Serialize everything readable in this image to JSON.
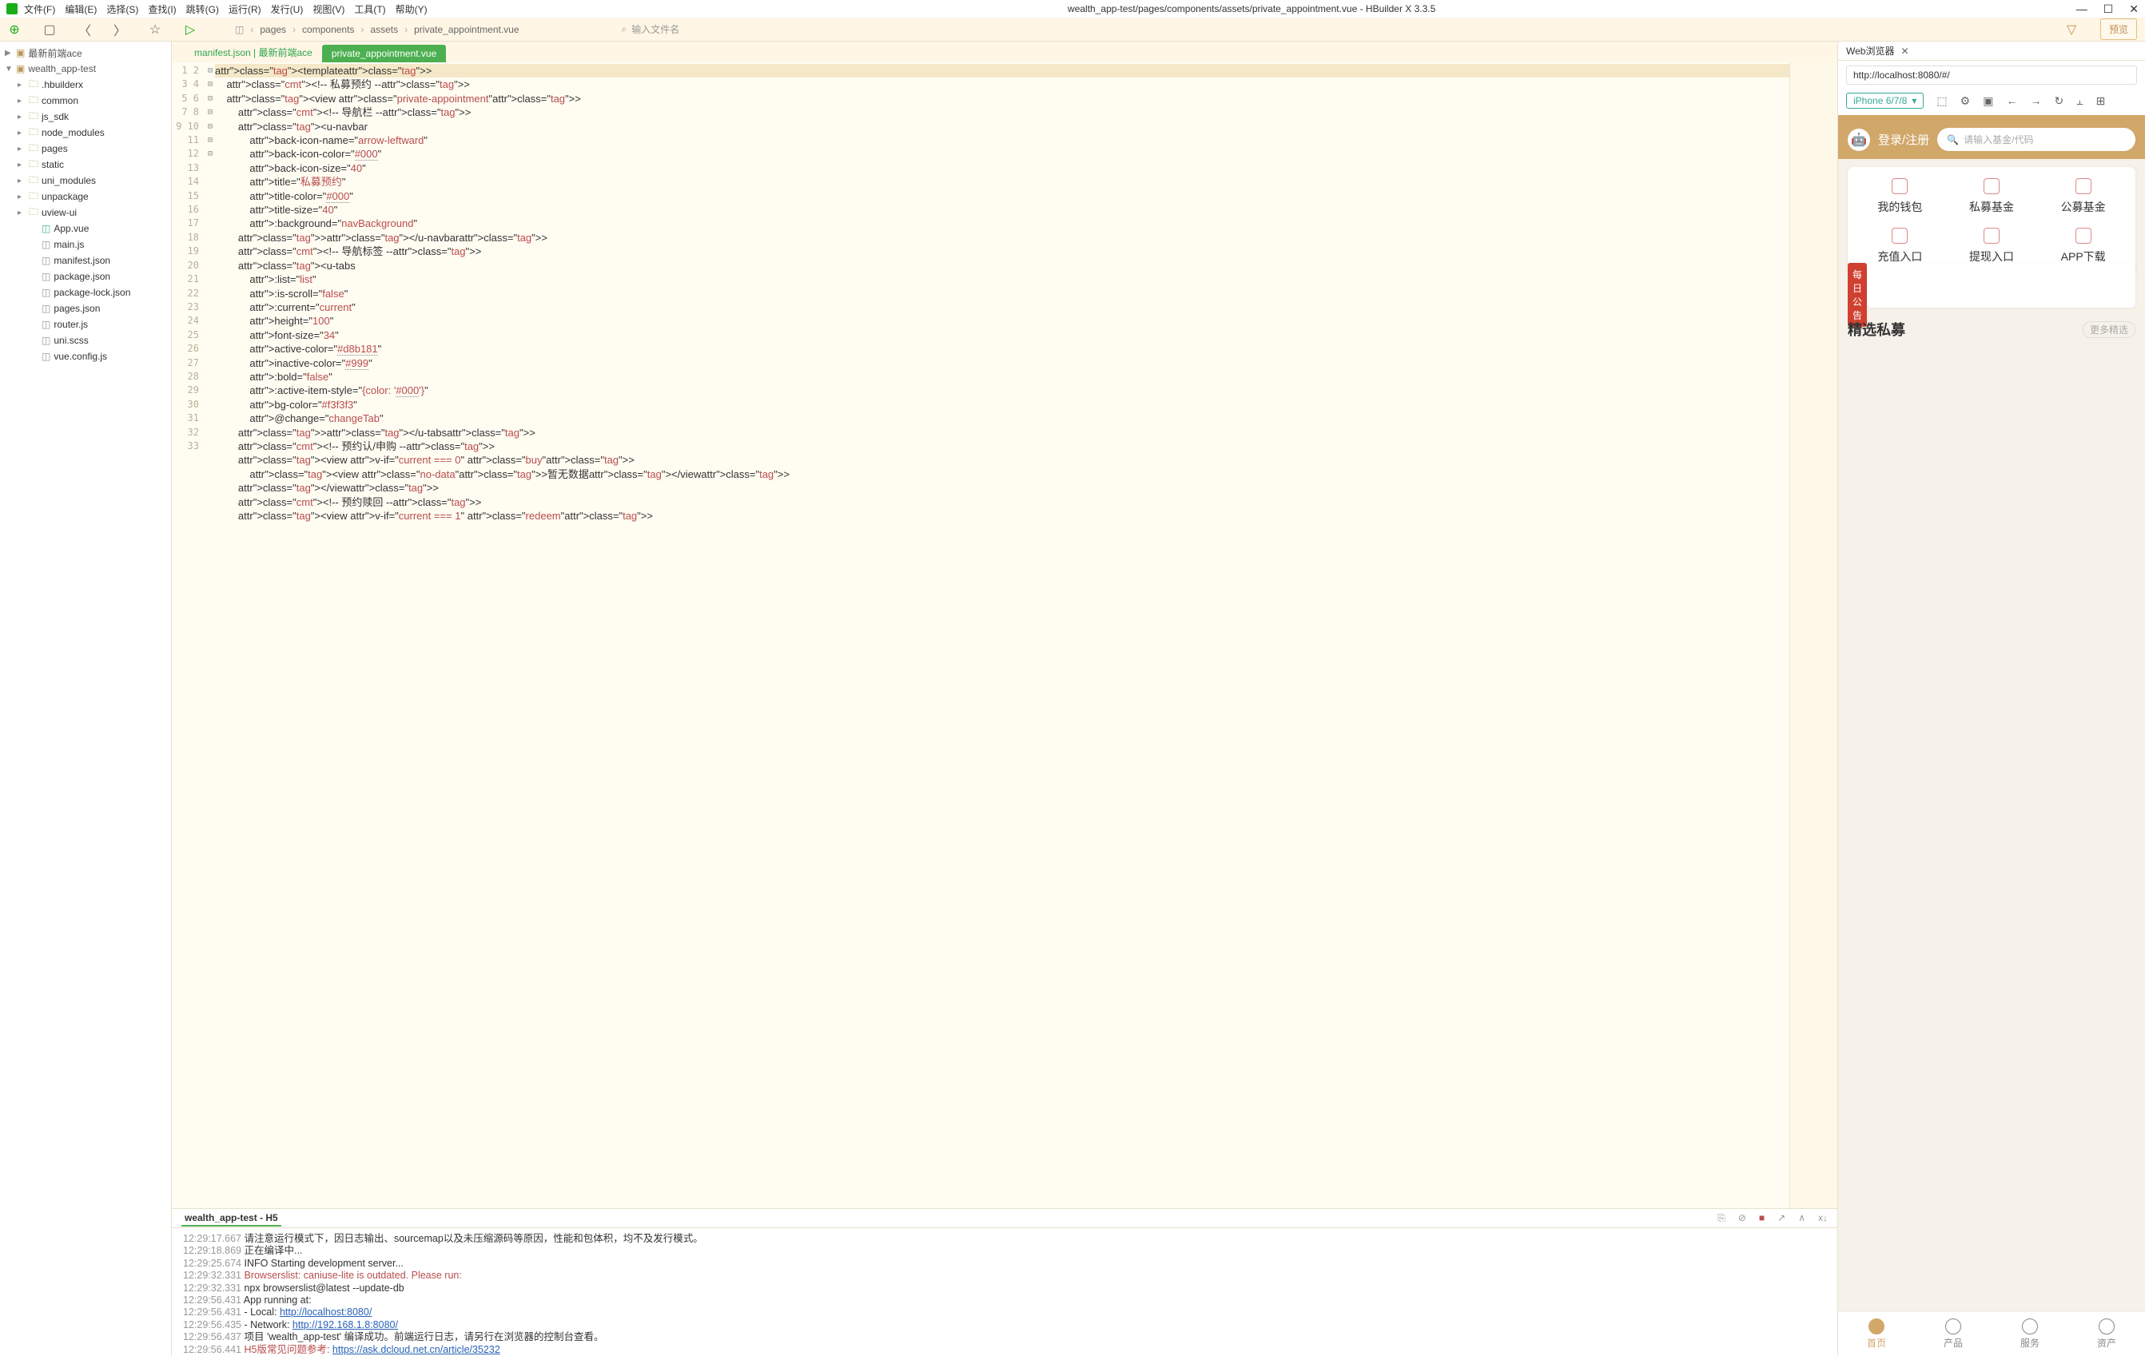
{
  "titlebar": {
    "menus": [
      "文件(F)",
      "编辑(E)",
      "选择(S)",
      "查找(I)",
      "跳转(G)",
      "运行(R)",
      "发行(U)",
      "视图(V)",
      "工具(T)",
      "帮助(Y)"
    ],
    "title": "wealth_app-test/pages/components/assets/private_appointment.vue - HBuilder X 3.3.5"
  },
  "breadcrumb": [
    "pages",
    "components",
    "assets",
    "private_appointment.vue"
  ],
  "toolbar": {
    "search_placeholder": "输入文件名",
    "preview": "预览"
  },
  "sidebar": {
    "roots": [
      {
        "label": "最新前端ace",
        "chev": "▶"
      },
      {
        "label": "wealth_app-test",
        "chev": "▼"
      }
    ],
    "folders": [
      ".hbuilderx",
      "common",
      "js_sdk",
      "node_modules",
      "pages",
      "static",
      "uni_modules",
      "unpackage",
      "uview-ui"
    ],
    "files": [
      {
        "label": "App.vue",
        "cls": "vue"
      },
      {
        "label": "main.js",
        "cls": ""
      },
      {
        "label": "manifest.json",
        "cls": "json"
      },
      {
        "label": "package.json",
        "cls": "json"
      },
      {
        "label": "package-lock.json",
        "cls": "json"
      },
      {
        "label": "pages.json",
        "cls": "json"
      },
      {
        "label": "router.js",
        "cls": ""
      },
      {
        "label": "uni.scss",
        "cls": ""
      },
      {
        "label": "vue.config.js",
        "cls": ""
      }
    ]
  },
  "tabs": {
    "inactive": "manifest.json | 最新前端ace",
    "active": "private_appointment.vue"
  },
  "code": {
    "lines": [
      "<template>",
      "    <!-- 私募预约 -->",
      "    <view class=\"private-appointment\">",
      "        <!-- 导航栏 -->",
      "        <u-navbar",
      "            back-icon-name=\"arrow-leftward\"",
      "            back-icon-color=\"#000\"",
      "            back-icon-size=\"40\"",
      "            title=\"私募预约\"",
      "            title-color=\"#000\"",
      "            title-size=\"40\"",
      "            :background=\"navBackground\"",
      "        ></u-navbar>",
      "        <!-- 导航标签 -->",
      "        <u-tabs",
      "            :list=\"list\"",
      "            :is-scroll=\"false\"",
      "            :current=\"current\"",
      "            height=\"100\"",
      "            font-size=\"34\"",
      "            active-color=\"#d8b181\"",
      "            inactive-color=\"#999\"",
      "            :bold=\"false\"",
      "            :active-item-style=\"{color: '#000'}\"",
      "            bg-color=\"#f3f3f3\"",
      "            @change=\"changeTab\"",
      "        ></u-tabs>",
      "        <!-- 预约认/申购 -->",
      "        <view v-if=\"current === 0\" class=\"buy\">",
      "            <view class=\"no-data\">暂无数据</view>",
      "        </view>",
      "        <!-- 预约赎回 -->",
      "        <view v-if=\"current === 1\" class=\"redeem\">"
    ]
  },
  "console": {
    "tab": "wealth_app-test - H5",
    "lines": [
      {
        "ts": "12:29:17.667",
        "txt": "请注意运行模式下，因日志输出、sourcemap以及未压缩源码等原因，性能和包体积，均不及发行模式。"
      },
      {
        "ts": "12:29:18.869",
        "txt": "正在编译中..."
      },
      {
        "ts": "12:29:25.674",
        "txt": " INFO  Starting development server..."
      },
      {
        "ts": "12:29:32.331",
        "txt": "Browserslist: caniuse-lite is outdated. Please run:",
        "warn": true
      },
      {
        "ts": "12:29:32.331",
        "txt": "npx browserslist@latest --update-db"
      },
      {
        "ts": "12:29:56.431",
        "txt": "  App running at:"
      },
      {
        "ts": "12:29:56.431",
        "txt": "  - Local:   ",
        "link": "http://localhost:8080/"
      },
      {
        "ts": "12:29:56.435",
        "txt": "  - Network: ",
        "link": "http://192.168.1.8:8080/"
      },
      {
        "ts": "12:29:56.437",
        "txt": "项目 'wealth_app-test' 编译成功。前端运行日志，请另行在浏览器的控制台查看。"
      },
      {
        "ts": "12:29:56.441",
        "txt": "H5版常见问题参考: ",
        "link": "https://ask.dcloud.net.cn/article/35232",
        "warn": true
      }
    ]
  },
  "browser": {
    "tab": "Web浏览器",
    "url": "http://localhost:8080/#/",
    "device": "iPhone 6/7/8",
    "app": {
      "login": "登录/注册",
      "search_placeholder": "请输入基金/代码",
      "grid": [
        "我的钱包",
        "私募基金",
        "公募基金",
        "充值入口",
        "提现入口",
        "APP下载"
      ],
      "daily": "每日公告",
      "section": "精选私募",
      "more": "更多精选",
      "tabbar": [
        "首页",
        "产品",
        "服务",
        "资产"
      ]
    }
  }
}
